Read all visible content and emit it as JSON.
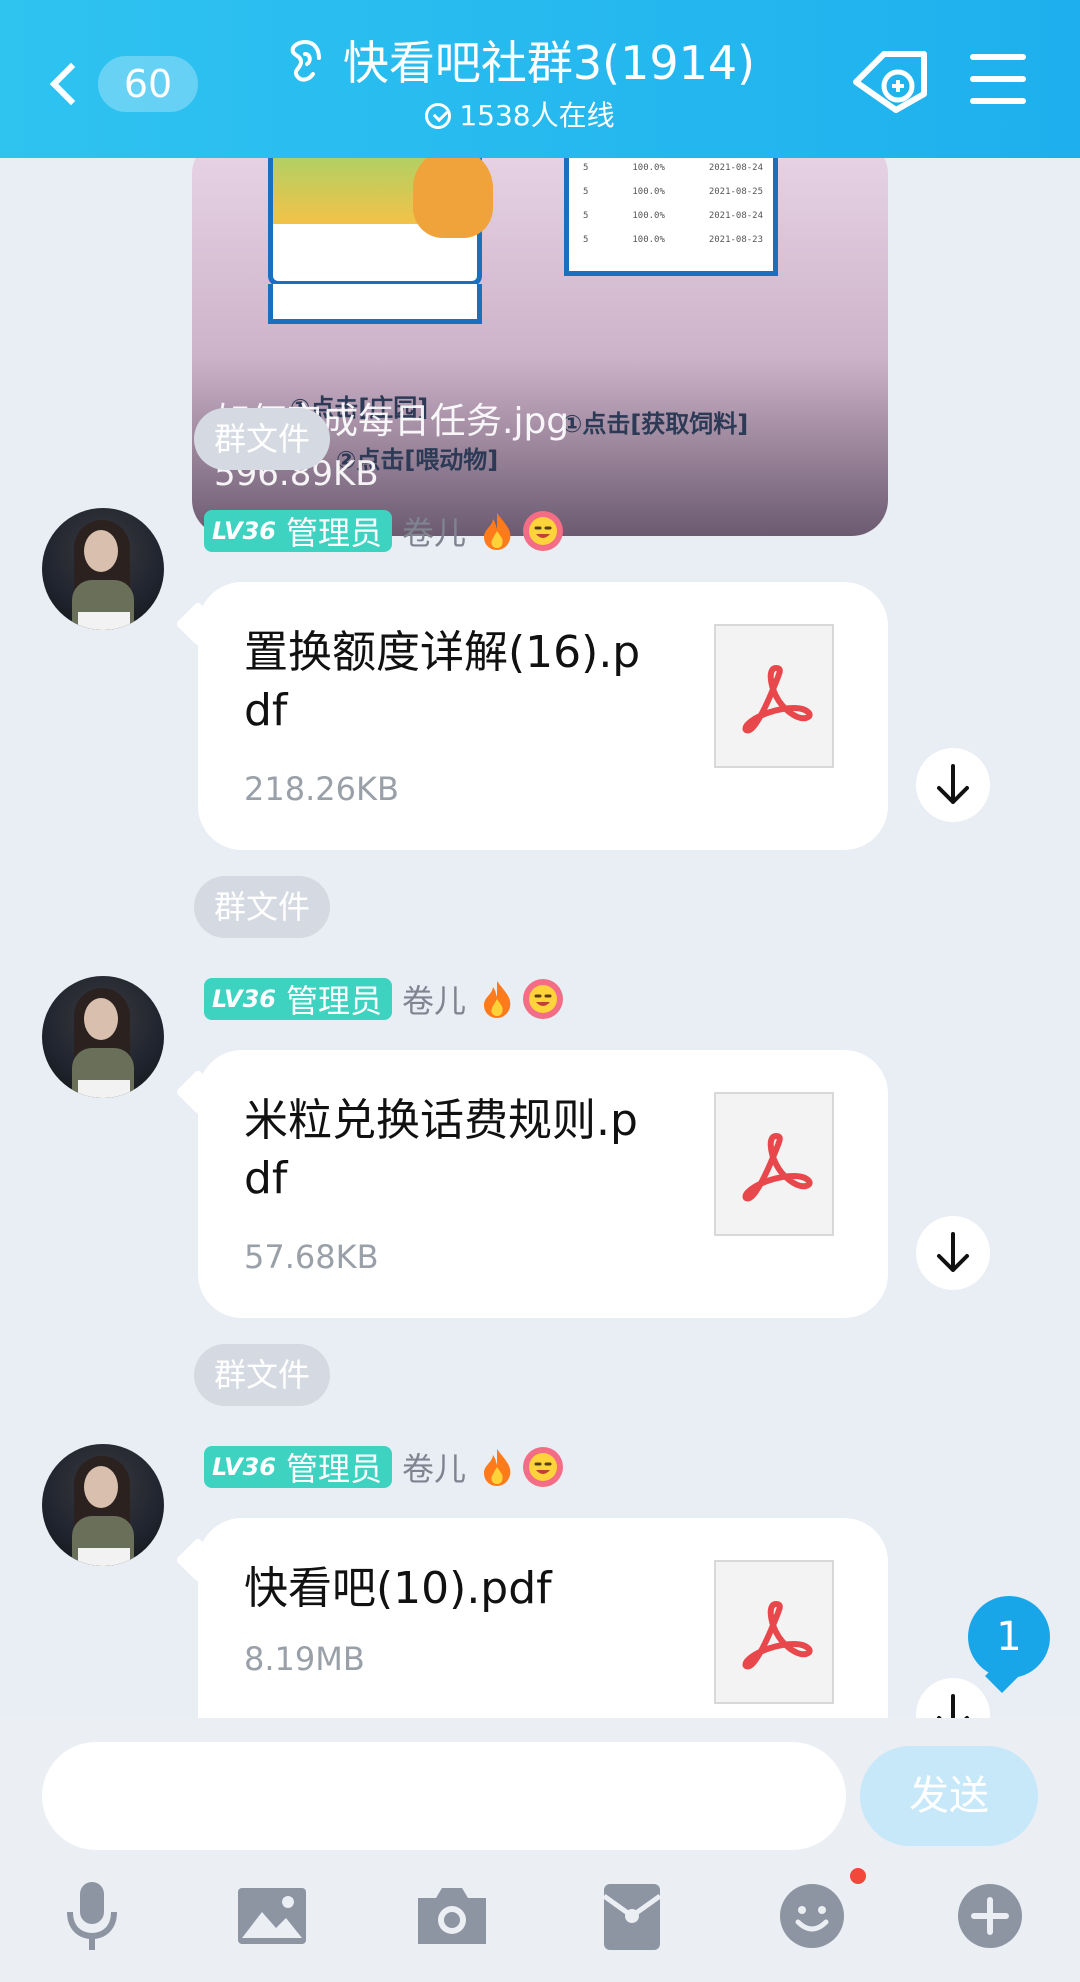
{
  "header": {
    "back_count": "60",
    "title": "快看吧社群3(1914)",
    "online": "1538人在线"
  },
  "image_message": {
    "filename": "如何完成每日任务.jpg",
    "filesize": "596.89KB",
    "caption_left": "①点击[庄园]",
    "caption_right": "①点击[获取饲料]",
    "caption_sub": "②点击[喂动物]",
    "table_rows": [
      {
        "c1": "5",
        "c2": "100.0%",
        "c3": "2021-08-24"
      },
      {
        "c1": "5",
        "c2": "100.0%",
        "c3": "2021-08-25"
      },
      {
        "c1": "5",
        "c2": "100.0%",
        "c3": "2021-08-24"
      },
      {
        "c1": "5",
        "c2": "100.0%",
        "c3": "2021-08-23"
      }
    ]
  },
  "messages": [
    {
      "tag": "群文件",
      "level": "LV36",
      "role": "管理员",
      "sender": "卷儿",
      "file_name": "置换额度详解(16).pdf",
      "file_size": "218.26KB"
    },
    {
      "tag": "群文件",
      "level": "LV36",
      "role": "管理员",
      "sender": "卷儿",
      "file_name": "米粒兑换话费规则.pdf",
      "file_size": "57.68KB"
    },
    {
      "tag": "群文件",
      "level": "LV36",
      "role": "管理员",
      "sender": "卷儿",
      "file_name": "快看吧(10).pdf",
      "file_size": "8.19MB"
    }
  ],
  "new_message_count": "1",
  "input": {
    "value": "",
    "send_label": "发送"
  },
  "icons": {
    "voice": "microphone-icon",
    "image": "picture-icon",
    "camera": "camera-icon",
    "redpacket": "red-packet-icon",
    "emoji": "emoji-icon",
    "more": "plus-icon"
  },
  "colors": {
    "header": "#1eb0ee",
    "level_badge": "#3dd3c0",
    "badge": "#19a6e8",
    "background": "#e9edf4"
  }
}
